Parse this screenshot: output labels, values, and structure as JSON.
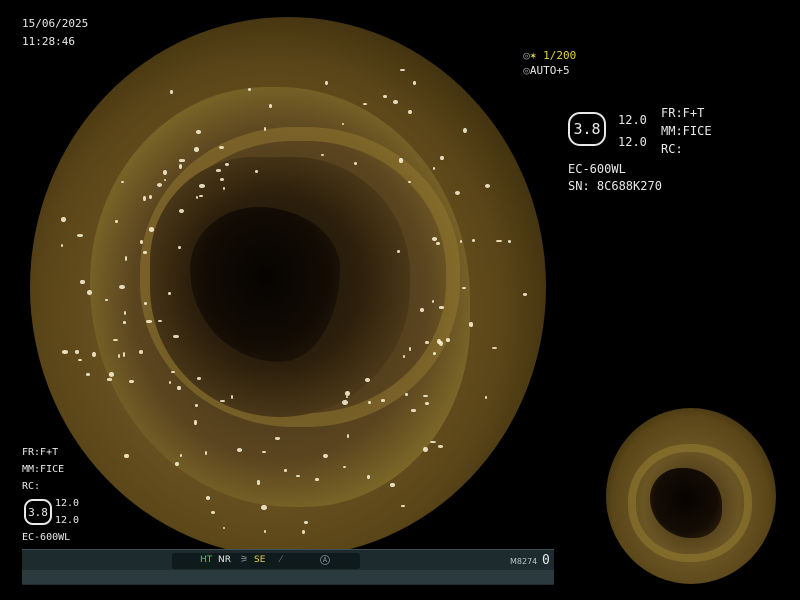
{
  "datetime": {
    "date": "15/06/2025",
    "time": "11:28:46"
  },
  "exposure": {
    "shutter": "✶ 1/200",
    "auto": "AUTO+5",
    "shutter_icon": "camera-settings-icon",
    "auto_icon": "auto-iris-icon"
  },
  "scope_info": {
    "badge": "3.8",
    "vals": [
      "12.0",
      "12.0"
    ],
    "fr": "FR:F+T",
    "mm": "MM:FICE",
    "rc": "RC:",
    "model": "EC-600WL",
    "serial": "SN: 8C688K270"
  },
  "left_info": {
    "fr": "FR:F+T",
    "mm": "MM:FICE",
    "rc": "RC:",
    "badge": "3.8",
    "vals": [
      "12.0",
      "12.0"
    ],
    "model": "EC-600WL"
  },
  "status_bar": {
    "ht": "HT",
    "nr": "NR",
    "se": "SE",
    "code": "M8274",
    "count": "0",
    "colors": {
      "ht": "#3fd34a",
      "nr": "#e8e8e8",
      "se": "#e6d23a",
      "bar": "#1d2b2f"
    }
  }
}
